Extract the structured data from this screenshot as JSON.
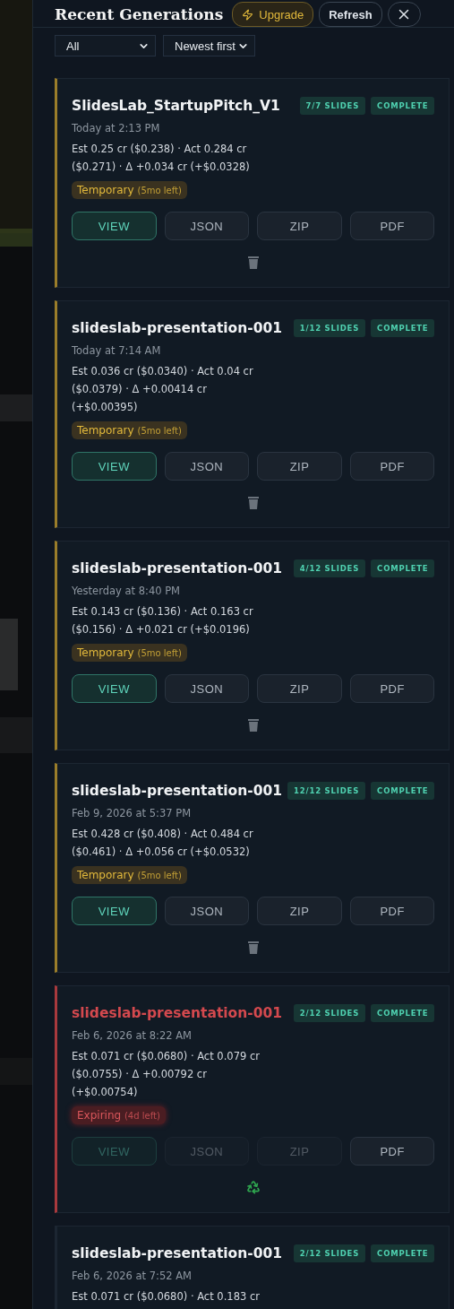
{
  "header": {
    "title": "Recent Generations",
    "upgrade": "Upgrade",
    "refresh": "Refresh"
  },
  "filters": [
    {
      "value": "All"
    },
    {
      "value": "Newest first"
    }
  ],
  "generations": [
    {
      "title": "SlidesLab_StartupPitch_V1",
      "slides": "7/7 SLIDES",
      "status": "COMPLETE",
      "date": "Today at 2:13 PM",
      "cost": "Est 0.25 cr ($0.238) · Act 0.284 cr ($0.271) · Δ +0.034 cr (+$0.0328)",
      "retention": {
        "kind": "temporary",
        "label": "Temporary",
        "remaining": "(5mo left)"
      },
      "actions": [
        {
          "label": "VIEW",
          "kind": "primary",
          "disabled": false
        },
        {
          "label": "JSON",
          "kind": "plain",
          "disabled": false
        },
        {
          "label": "ZIP",
          "kind": "plain",
          "disabled": false
        },
        {
          "label": "PDF",
          "kind": "plain",
          "disabled": false
        }
      ],
      "cleanup": {
        "kind": "trash"
      }
    },
    {
      "title": "slideslab-presentation-001",
      "slides": "1/12 SLIDES",
      "status": "COMPLETE",
      "date": "Today at 7:14 AM",
      "cost": "Est 0.036 cr ($0.0340) · Act 0.04 cr ($0.0379) · Δ +0.00414 cr (+$0.00395)",
      "retention": {
        "kind": "temporary",
        "label": "Temporary",
        "remaining": "(5mo left)"
      },
      "actions": [
        {
          "label": "VIEW",
          "kind": "primary",
          "disabled": false
        },
        {
          "label": "JSON",
          "kind": "plain",
          "disabled": false
        },
        {
          "label": "ZIP",
          "kind": "plain",
          "disabled": false
        },
        {
          "label": "PDF",
          "kind": "plain",
          "disabled": false
        }
      ],
      "cleanup": {
        "kind": "trash"
      }
    },
    {
      "title": "slideslab-presentation-001",
      "slides": "4/12 SLIDES",
      "status": "COMPLETE",
      "date": "Yesterday at 8:40 PM",
      "cost": "Est 0.143 cr ($0.136) · Act 0.163 cr ($0.156) · Δ +0.021 cr (+$0.0196)",
      "retention": {
        "kind": "temporary",
        "label": "Temporary",
        "remaining": "(5mo left)"
      },
      "actions": [
        {
          "label": "VIEW",
          "kind": "primary",
          "disabled": false
        },
        {
          "label": "JSON",
          "kind": "plain",
          "disabled": false
        },
        {
          "label": "ZIP",
          "kind": "plain",
          "disabled": false
        },
        {
          "label": "PDF",
          "kind": "plain",
          "disabled": false
        }
      ],
      "cleanup": {
        "kind": "trash"
      }
    },
    {
      "title": "slideslab-presentation-001",
      "slides": "12/12 SLIDES",
      "status": "COMPLETE",
      "date": "Feb 9, 2026 at 5:37 PM",
      "cost": "Est 0.428 cr ($0.408) · Act 0.484 cr ($0.461) · Δ +0.056 cr (+$0.0532)",
      "retention": {
        "kind": "temporary",
        "label": "Temporary",
        "remaining": "(5mo left)"
      },
      "actions": [
        {
          "label": "VIEW",
          "kind": "primary",
          "disabled": false
        },
        {
          "label": "JSON",
          "kind": "plain",
          "disabled": false
        },
        {
          "label": "ZIP",
          "kind": "plain",
          "disabled": false
        },
        {
          "label": "PDF",
          "kind": "plain",
          "disabled": false
        }
      ],
      "cleanup": {
        "kind": "trash"
      }
    },
    {
      "title": "slideslab-presentation-001",
      "slides": "2/12 SLIDES",
      "status": "COMPLETE",
      "date": "Feb 6, 2026 at 8:22 AM",
      "cost": "Est 0.071 cr ($0.0680) · Act 0.079 cr ($0.0755) · Δ +0.00792 cr (+$0.00754)",
      "retention": {
        "kind": "expiring",
        "label": "Expiring",
        "remaining": "(4d left)"
      },
      "actions": [
        {
          "label": "VIEW",
          "kind": "primary",
          "disabled": true
        },
        {
          "label": "JSON",
          "kind": "plain",
          "disabled": true
        },
        {
          "label": "ZIP",
          "kind": "plain",
          "disabled": true
        },
        {
          "label": "PDF",
          "kind": "plain",
          "disabled": false
        }
      ],
      "cleanup": {
        "kind": "recycle"
      }
    },
    {
      "title": "slideslab-presentation-001",
      "slides": "2/12 SLIDES",
      "status": "COMPLETE",
      "date": "Feb 6, 2026 at 7:52 AM",
      "cost": "Est 0.071 cr ($0.0680) · Act 0.183 cr"
    }
  ]
}
